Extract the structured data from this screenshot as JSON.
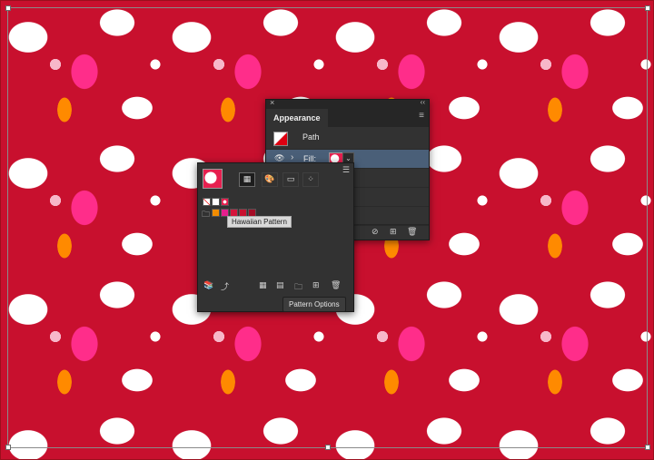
{
  "colors": {
    "pattern_background": "#c8102e",
    "panel_bg": "#323232",
    "selected_row": "#4a5f78"
  },
  "appearance_panel": {
    "tab_label": "Appearance",
    "close_icon": "close-icon",
    "collapse_icon": "double-chevron-icon",
    "menu_icon": "hamburger-menu-icon",
    "path_label": "Path",
    "fill_label": "Fill:",
    "footer_icons": [
      "clear-appearance-icon",
      "duplicate-item-icon",
      "trash-icon"
    ]
  },
  "swatches_panel": {
    "swatch_kind_buttons": [
      "pattern-swatch-icon",
      "color-group-icon",
      "gradient-swatch-icon",
      "list-view-icon"
    ],
    "chips": [
      {
        "name": "none-swatch",
        "color": "#ffffff"
      },
      {
        "name": "registration-swatch",
        "color": "#ffffff"
      },
      {
        "name": "pattern-swatch",
        "color": "#e61f4f"
      },
      {
        "name": "orange-swatch",
        "color": "#f28c00"
      },
      {
        "name": "pink-swatch",
        "color": "#e61f8e"
      },
      {
        "name": "red-swatch",
        "color": "#d4143b"
      },
      {
        "name": "crimson-swatch",
        "color": "#c8102e"
      },
      {
        "name": "dark-red-swatch",
        "color": "#a50c26"
      }
    ],
    "tooltip": "Hawaiian Pattern",
    "toolbar_icons": [
      "swatch-libraries-icon",
      "place-swatch-icon",
      "show-kinds-icon",
      "swatch-options-icon",
      "new-color-group-icon",
      "new-swatch-icon",
      "trash-icon"
    ],
    "pattern_options_label": "Pattern Options"
  }
}
